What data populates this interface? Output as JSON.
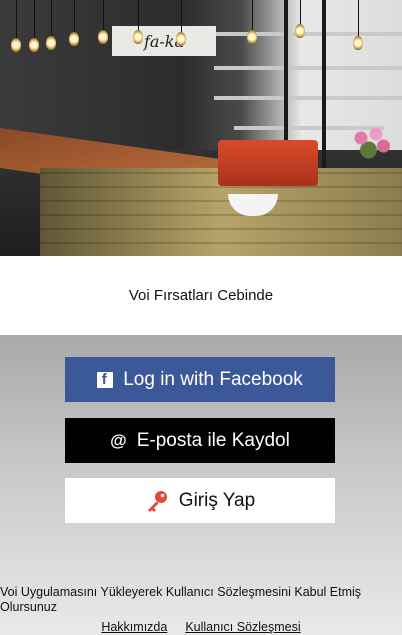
{
  "hero": {
    "sign_text": "fa-ka"
  },
  "tagline": "Voi Fırsatları Cebinde",
  "buttons": {
    "facebook": {
      "label": "Log in with Facebook",
      "icon": "facebook-icon",
      "color": "#3b5998"
    },
    "email": {
      "label": "E-posta ile Kaydol",
      "icon": "at-icon",
      "color": "#000000"
    },
    "login": {
      "label": "Giriş Yap",
      "icon": "key-icon",
      "color": "#ffffff",
      "icon_color": "#e8453c"
    }
  },
  "terms_text": "Voi Uygulamasını Yükleyerek Kullanıcı Sözleşmesini Kabul Etmiş Olursunuz",
  "links": {
    "about": "Hakkımızda",
    "agreement": "Kullanıcı Sözleşmesi"
  }
}
